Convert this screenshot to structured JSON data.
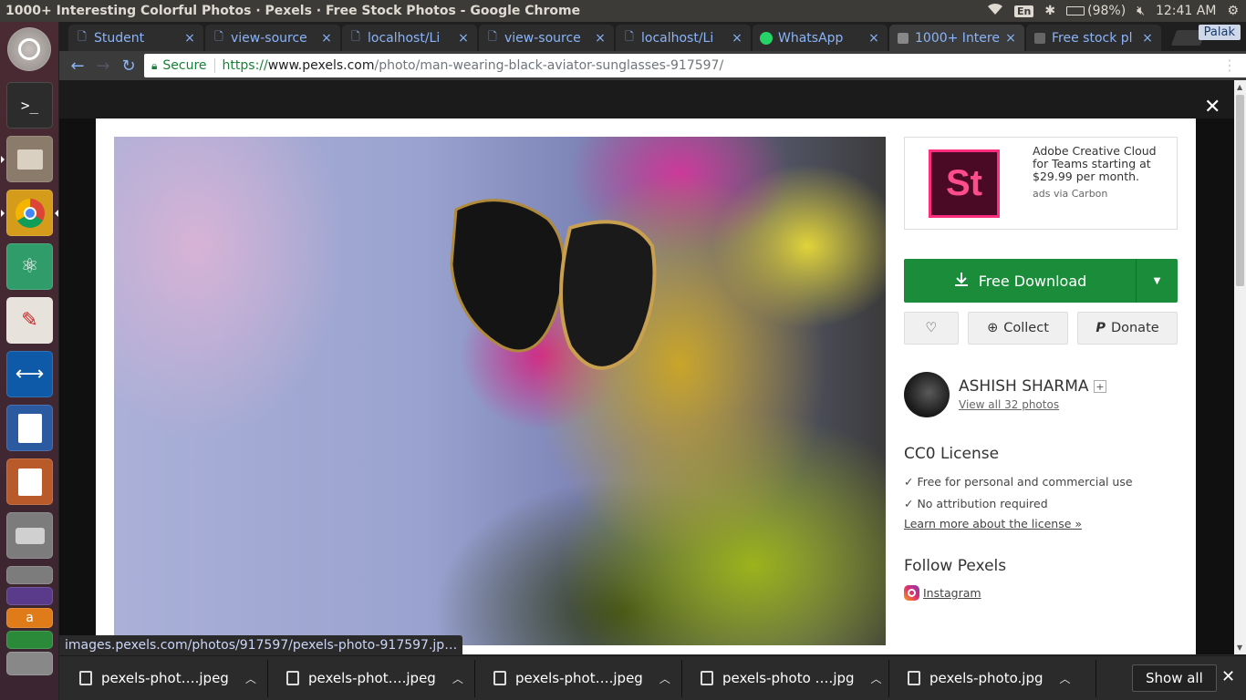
{
  "window": {
    "title": "1000+ Interesting Colorful Photos · Pexels · Free Stock Photos - Google Chrome"
  },
  "tray": {
    "lang": "En",
    "battery": "(98%)",
    "time": "12:41 AM"
  },
  "tabs": [
    {
      "label": "Student",
      "icon": "page-icon"
    },
    {
      "label": "view-source",
      "icon": "page-icon"
    },
    {
      "label": "localhost/Li",
      "icon": "page-icon"
    },
    {
      "label": "view-source",
      "icon": "page-icon"
    },
    {
      "label": "localhost/Li",
      "icon": "page-icon"
    },
    {
      "label": "WhatsApp",
      "icon": "whatsapp-icon"
    },
    {
      "label": "1000+ Intere",
      "icon": "pexels-icon",
      "active": true
    },
    {
      "label": "Free stock pl",
      "icon": "pexels-icon"
    }
  ],
  "profile": "Palak",
  "omnibox": {
    "secure": "Secure",
    "scheme": "https://",
    "host": "www.pexels.com",
    "path": "/photo/man-wearing-black-aviator-sunglasses-917597/"
  },
  "sidebar": {
    "ad": {
      "logo_text": "St",
      "text": "Adobe Creative Cloud for Teams starting at $29.99 per month.",
      "via": "ads via Carbon"
    },
    "download": {
      "label": "Free Download"
    },
    "actions": {
      "collect": "Collect",
      "donate": "Donate"
    },
    "author": {
      "name": "ASHISH SHARMA",
      "plus": "+",
      "view_all": "View all 32 photos"
    },
    "license": {
      "title": "CC0 License",
      "line1": "✓ Free for personal and commercial use",
      "line2": "✓ No attribution required",
      "link": "Learn more about the license »"
    },
    "follow": {
      "title": "Follow Pexels",
      "instagram": "Instagram"
    }
  },
  "status_bubble": "images.pexels.com/photos/917597/pexels-photo-917597.jp…",
  "downloads": [
    {
      "label": "pexels-phot….jpeg"
    },
    {
      "label": "pexels-phot….jpeg"
    },
    {
      "label": "pexels-phot….jpeg"
    },
    {
      "label": "pexels-photo ….jpg"
    },
    {
      "label": "pexels-photo.jpg"
    }
  ],
  "downloads_show_all": "Show all",
  "colors": {
    "download_green": "#1a8c3a",
    "link_blue": "#8ab4f8",
    "secure_green": "#188038"
  }
}
